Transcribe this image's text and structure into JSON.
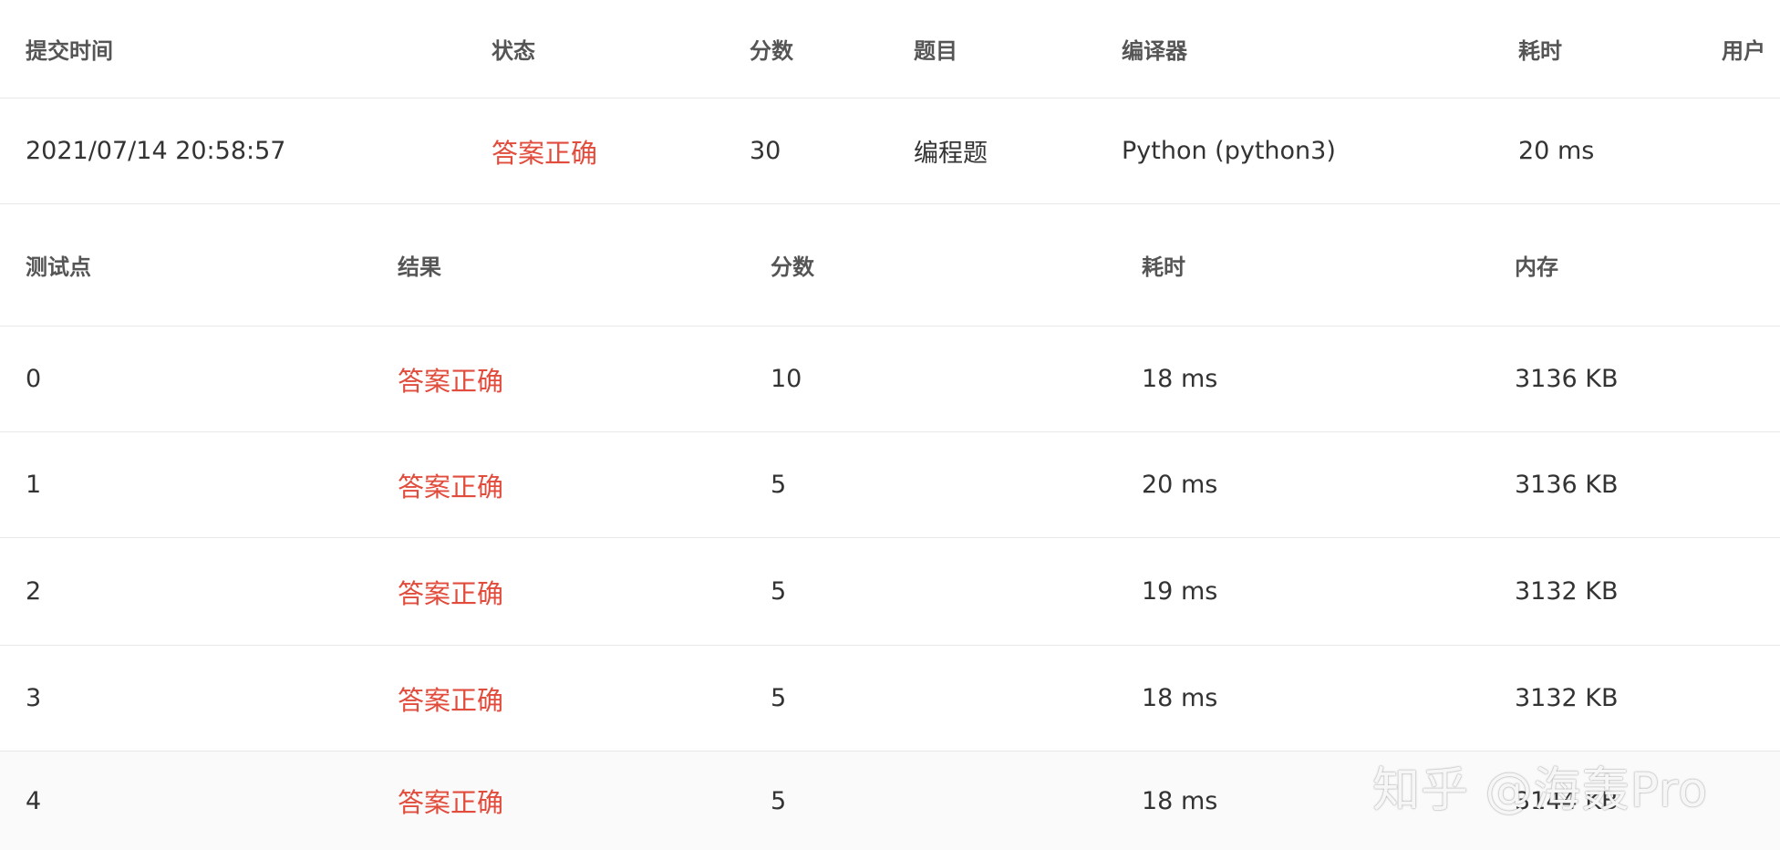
{
  "submission": {
    "headers": [
      "提交时间",
      "状态",
      "分数",
      "题目",
      "编译器",
      "耗时",
      "用户"
    ],
    "row": {
      "time": "2021/07/14 20:58:57",
      "status": "答案正确",
      "score": "30",
      "problem": "编程题",
      "compiler": "Python (python3)",
      "elapsed": "20 ms",
      "user": ""
    }
  },
  "testcases": {
    "headers": [
      "测试点",
      "结果",
      "分数",
      "耗时",
      "内存"
    ],
    "rows": [
      {
        "id": "0",
        "result": "答案正确",
        "score": "10",
        "time": "18 ms",
        "memory": "3136 KB"
      },
      {
        "id": "1",
        "result": "答案正确",
        "score": "5",
        "time": "20 ms",
        "memory": "3136 KB"
      },
      {
        "id": "2",
        "result": "答案正确",
        "score": "5",
        "time": "19 ms",
        "memory": "3132 KB"
      },
      {
        "id": "3",
        "result": "答案正确",
        "score": "5",
        "time": "18 ms",
        "memory": "3132 KB"
      },
      {
        "id": "4",
        "result": "答案正确",
        "score": "5",
        "time": "18 ms",
        "memory": "3144 KB"
      }
    ]
  },
  "watermark": "知乎 @海轰Pro",
  "colors": {
    "status_ok": "#e14c3c",
    "header_text": "#555555",
    "border": "#e8e8e8"
  }
}
